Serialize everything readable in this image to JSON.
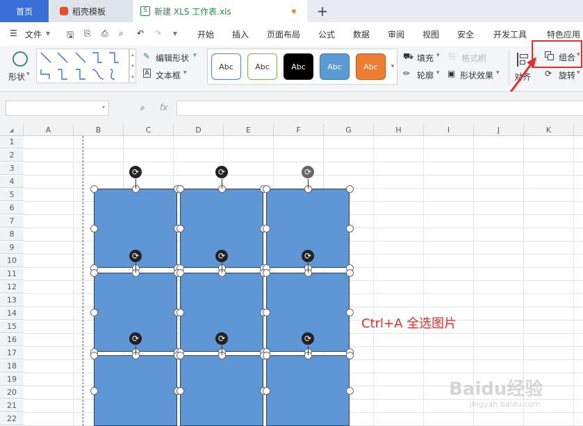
{
  "tabs": {
    "home": "首页",
    "template": "稻壳模板",
    "file": "新建 XLS 工作表.xls",
    "add": "+"
  },
  "menu": {
    "file": "文件",
    "items": [
      "开始",
      "插入",
      "页面布局",
      "公式",
      "数据",
      "审阅",
      "视图",
      "安全",
      "开发工具",
      "特色应用"
    ]
  },
  "ribbon": {
    "shape": "形状",
    "edit_shape": "编辑形状",
    "textbox": "文本框",
    "styles": [
      "Abc",
      "Abc",
      "Abc",
      "Abc",
      "Abc"
    ],
    "fill": "填充",
    "format_painter": "格式刷",
    "outline": "轮廓",
    "shape_effect": "形状效果",
    "align": "对齐",
    "group": "组合",
    "rotate": "旋转"
  },
  "formula": {
    "fx": "fx",
    "name_box": "",
    "value": ""
  },
  "columns": [
    "A",
    "B",
    "C",
    "D",
    "E",
    "F",
    "G",
    "H",
    "I",
    "J",
    "K"
  ],
  "rows": [
    "1",
    "2",
    "3",
    "4",
    "5",
    "6",
    "7",
    "8",
    "9",
    "10",
    "11",
    "12",
    "13",
    "14",
    "15",
    "16",
    "17",
    "18",
    "19",
    "20",
    "21",
    "22"
  ],
  "annotation": "Ctrl+A 全选图片",
  "watermark": "Baidu经验",
  "watermark_url": "jingyan.baidu.com",
  "colors": {
    "accent": "#3a6fd8",
    "shape_fill": "#5f97d6",
    "highlight": "#e82b2b"
  }
}
